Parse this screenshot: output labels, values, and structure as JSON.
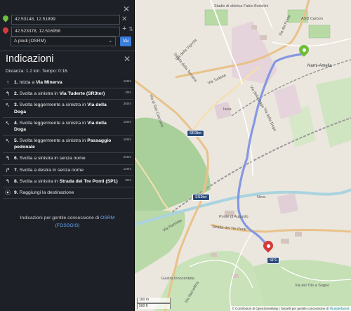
{
  "waypoints": {
    "start_value": "42.53148, 12.51899",
    "end_value": "42.523378, 12.516958"
  },
  "route_controls": {
    "mode_value": "A piedi (OSRM)",
    "go_label": "Vai"
  },
  "directions": {
    "title": "Indicazioni",
    "summary": "Distanza: 1.2 km. Tempo: 0:16.",
    "steps": [
      {
        "num": "1.",
        "pre": "Inizia a ",
        "name": "Via Minerva",
        "dist": "160m",
        "arrow": "↑"
      },
      {
        "num": "2.",
        "pre": "Svolta a sinistra in ",
        "name": "Via Tuderte (SR3ter)",
        "dist": "30m",
        "arrow": "↰"
      },
      {
        "num": "3.",
        "pre": "Svolta leggermente a sinistra in ",
        "name": "Via della Doga",
        "dist": "300m",
        "arrow": "↖"
      },
      {
        "num": "4.",
        "pre": "Svolta leggermente a sinistra in ",
        "name": "Via della Doga",
        "dist": "150m",
        "arrow": "↖"
      },
      {
        "num": "5.",
        "pre": "Svolta leggermente a sinistra in ",
        "name": "Passaggio pedonale",
        "dist": "160m",
        "arrow": "↖"
      },
      {
        "num": "6.",
        "pre": "Svolta a sinistra in senza nome",
        "name": "",
        "dist": "220m",
        "arrow": "↰"
      },
      {
        "num": "7.",
        "pre": "Svolta a destra in senza nome",
        "name": "",
        "dist": "120m",
        "arrow": "↱"
      },
      {
        "num": "8.",
        "pre": "Svolta a sinistra in ",
        "name": "Strada dei Tre Ponti (SP1)",
        "dist": "30m",
        "arrow": "↰"
      },
      {
        "num": "9.",
        "pre": "Raggiungi la destinazione",
        "name": "",
        "dist": "",
        "arrow": "⦿"
      }
    ],
    "credit_text": "Indicazioni per gentile concessione di ",
    "credit_link1": "OSRM",
    "credit_link2": "(FOSSGIS)"
  },
  "map": {
    "labels": {
      "stadio": "Stadio di atletica Fabio Bertolini",
      "asd": "ASD Carbon",
      "narni": "Narni-Amelia",
      "via_vignola": "Via della Vignola",
      "via_tuderte": "Via Tuderte",
      "strada_ternana": "Strada della Ternana",
      "via_doga1": "Via della Doga",
      "via_doga2": "Via della Doga",
      "via_ponte": "Via del Ponte",
      "ponte_augusto": "Ponte di Augusto",
      "strada_tre_ponti": "Strada dei Tre Ponti",
      "gastra": "Gastra Innocentata",
      "via_san_casciano": "Via di San Casciano",
      "via_flaminia": "Via Flaminia",
      "via_tito": "Via del Tito a Sogno",
      "via_marcellina": "Via Marcellina",
      "istituto": "Isola",
      "nera": "Nera"
    },
    "shields": {
      "sr3ter_a": "SR3ter",
      "sr3ter_b": "SS3ter",
      "sp1": "SP1"
    },
    "scale_metric": "100 m",
    "scale_imperial": "500 ft",
    "attribution": "© Contributori di OpenStreetMap | Tasselli per gentile concessione di",
    "attribution_link": "Thunderforest",
    "colors": {
      "route": "#7b8fe3",
      "start_marker": "#6fbf3a",
      "end_marker": "#d33b3b",
      "panel_bg": "#1d2127",
      "accent": "#3b7ddd"
    }
  }
}
